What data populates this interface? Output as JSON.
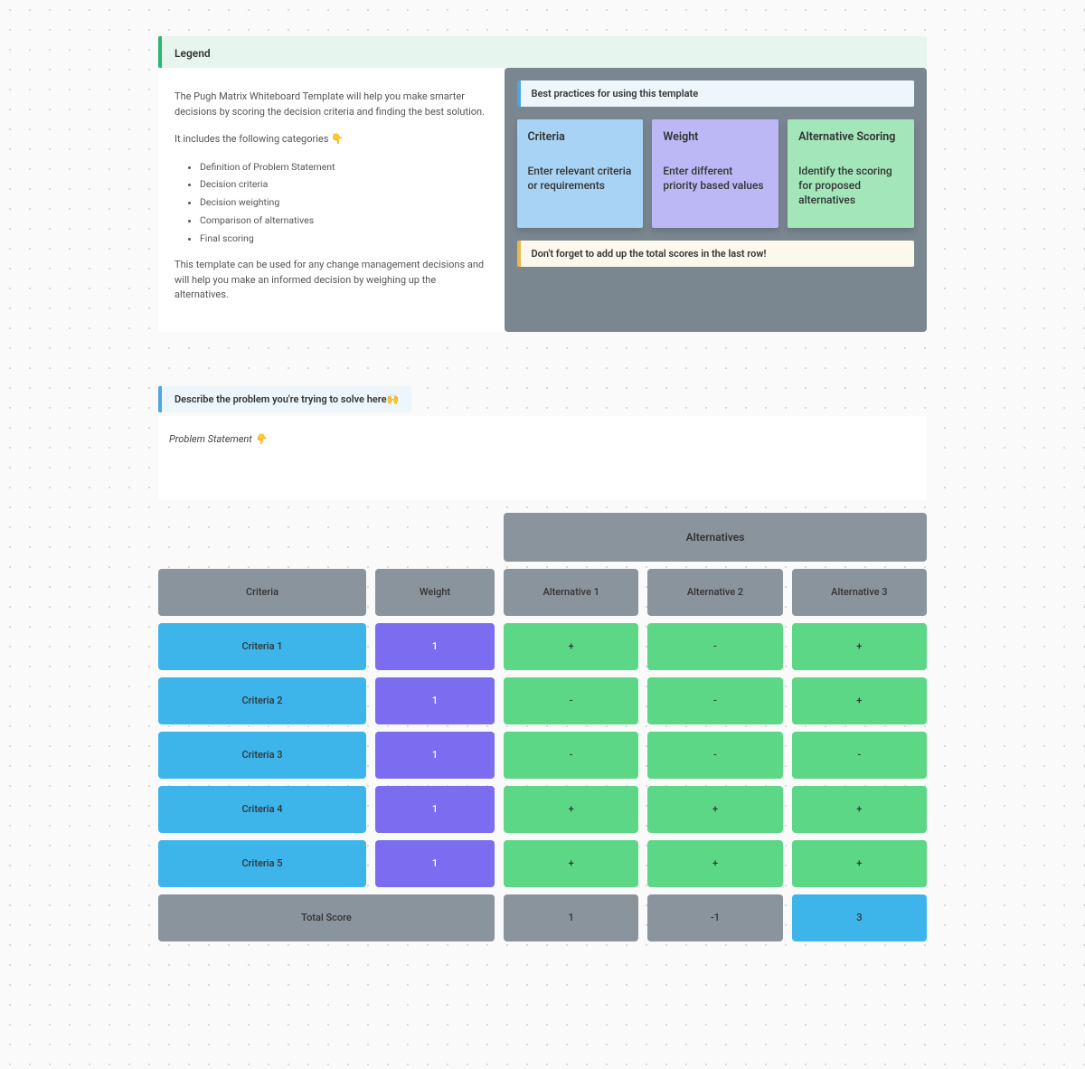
{
  "legend": {
    "title": "Legend"
  },
  "description": {
    "intro": "The Pugh Matrix Whiteboard Template will help you make smarter decisions by scoring the decision criteria and finding the best solution.",
    "includesLabel": "It includes the following categories 👇",
    "categories": [
      "Definition of Problem Statement",
      "Decision criteria",
      "Decision weighting",
      "Comparison of alternatives",
      "Final scoring"
    ],
    "outro": "This template can be used for any change management decisions and will help you make an informed decision by weighing up the alternatives."
  },
  "bestPractices": {
    "title": "Best practices for using this template",
    "cards": [
      {
        "heading": "Criteria",
        "body": "Enter relevant criteria or requirements"
      },
      {
        "heading": "Weight",
        "body": "Enter different priority based values"
      },
      {
        "heading": "Alternative Scoring",
        "body": "Identify the scoring for proposed alternatives"
      }
    ],
    "note": "Don't forget to add up the total scores in the last row!"
  },
  "problem": {
    "header": "Describe the problem you're trying to solve here🙌",
    "statementLabel": "Problem Statement  👇"
  },
  "matrix": {
    "alternativesHeader": "Alternatives",
    "criteriaHeader": "Criteria",
    "weightHeader": "Weight",
    "altHeaders": [
      "Alternative 1",
      "Alternative 2",
      "Alternative 3"
    ],
    "rows": [
      {
        "criteria": "Criteria 1",
        "weight": "1",
        "scores": [
          "+",
          "-",
          "+"
        ]
      },
      {
        "criteria": "Criteria 2",
        "weight": "1",
        "scores": [
          "-",
          "-",
          "+"
        ]
      },
      {
        "criteria": "Criteria 3",
        "weight": "1",
        "scores": [
          "-",
          "-",
          "-"
        ]
      },
      {
        "criteria": "Criteria 4",
        "weight": "1",
        "scores": [
          "+",
          "+",
          "+"
        ]
      },
      {
        "criteria": "Criteria 5",
        "weight": "1",
        "scores": [
          "+",
          "+",
          "+"
        ]
      }
    ],
    "totalLabel": "Total Score",
    "totals": [
      "1",
      "-1",
      "3"
    ]
  }
}
